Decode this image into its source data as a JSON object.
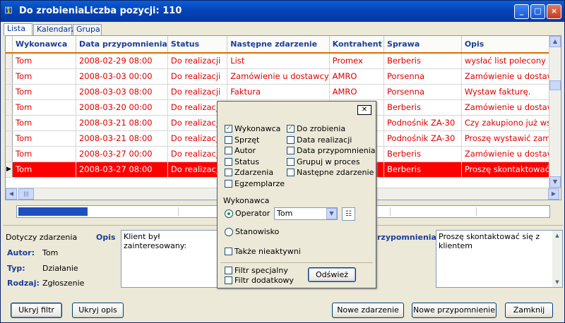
{
  "window": {
    "title": "Do zrobienia",
    "count_label": "Liczba pozycji: 110",
    "minimize_icon": "_",
    "maximize_icon": "□",
    "close_icon": "×"
  },
  "tabs": [
    {
      "label": "Lista",
      "active": true
    },
    {
      "label": "Kalendarz",
      "active": false
    },
    {
      "label": "Grupa",
      "active": false
    }
  ],
  "grid": {
    "columns": [
      "Wykonawca",
      "Data przypomnienia",
      "Status",
      "Następne zdarzenie",
      "Kontrahent",
      "Sprawa",
      "Opis"
    ],
    "rows": [
      {
        "cells": [
          "Tom",
          "2008-02-29 08:00",
          "Do realizacji",
          "List",
          "Promex",
          "Berberis",
          "wysłać list polecony"
        ],
        "selected": false
      },
      {
        "cells": [
          "Tom",
          "2008-03-03 00:00",
          "Do realizacji",
          "Zamówienie u dostawcy",
          "AMRO",
          "Porsenna",
          "Zamówienie u dostaw"
        ],
        "selected": false
      },
      {
        "cells": [
          "Tom",
          "2008-03-03 08:00",
          "Do realizacji",
          "Faktura",
          "AMRO",
          "Porsenna",
          "Wystaw fakturę."
        ],
        "selected": false
      },
      {
        "cells": [
          "Tom",
          "2008-03-20 00:00",
          "Do realizacji",
          "",
          "",
          "Berberis",
          "Zamówienie u dostaw"
        ],
        "selected": false
      },
      {
        "cells": [
          "Tom",
          "2008-03-21 08:00",
          "Do realizacji",
          "",
          "",
          "Podnośnik ZA-30",
          "Czy zakupiono już wszy"
        ],
        "selected": false
      },
      {
        "cells": [
          "Tom",
          "2008-03-21 08:00",
          "Do realizacji",
          "",
          "",
          "Podnośnik ZA-30",
          "Proszę wystawić zamó"
        ],
        "selected": false
      },
      {
        "cells": [
          "Tom",
          "2008-03-27 00:00",
          "Do realizacji",
          "",
          "",
          "Berberis",
          "Zamówienie u dostaw"
        ],
        "selected": false
      },
      {
        "cells": [
          "Tom",
          "2008-03-27 08:00",
          "Do realizacji",
          "",
          "",
          "Berberis",
          "Proszę skontaktować si"
        ],
        "selected": true
      }
    ],
    "row_indicator": "▶",
    "hscroll_left": "◀",
    "hscroll_right": "▶",
    "vscroll_up": "▲",
    "vscroll_down": "▼",
    "hscroll_thumb": "|||"
  },
  "progress": {
    "fraction": 0.13
  },
  "details": {
    "dotyczy_label": "Dotyczy zdarzenia",
    "opis_label": "Opis",
    "autor_label": "Autor:",
    "autor_value": "Tom",
    "typ_label": "Typ:",
    "typ_value": "Działanie",
    "rodzaj_label": "Rodzaj:",
    "rodzaj_value": "Zgłoszenie",
    "opis_text": "Klient był zainteresowany:",
    "przypomnienia_label": "rzypomnienia",
    "przypomnienia_text": "Proszę skontaktować się z klientem"
  },
  "buttons": {
    "ukryj_filtr": "Ukryj filtr",
    "ukryj_opis": "Ukryj opis",
    "nowe_zdarzenie": "Nowe zdarzenie",
    "nowe_przypomnienie": "Nowe przypomnienie",
    "zamknij": "Zamknij"
  },
  "filter": {
    "close_icon": "✕",
    "left_checks": [
      {
        "label": "Wykonawca",
        "checked": true
      },
      {
        "label": "Sprzęt",
        "checked": false
      },
      {
        "label": "Autor",
        "checked": false
      },
      {
        "label": "Status",
        "checked": false
      },
      {
        "label": "Zdarzenia",
        "checked": false
      },
      {
        "label": "Egzemplarze",
        "checked": false
      }
    ],
    "right_checks": [
      {
        "label": "Do zrobienia",
        "checked": true
      },
      {
        "label": "Data realizacji",
        "checked": false
      },
      {
        "label": "Data przypomnienia",
        "checked": false
      },
      {
        "label": "Grupuj w proces",
        "checked": false
      },
      {
        "label": "Następne zdarzenie",
        "checked": false
      }
    ],
    "wykonawca_label": "Wykonawca",
    "operator_label": "Operator",
    "operator_selected": true,
    "operator_value": "Tom",
    "stanowisko_label": "Stanowisko",
    "stanowisko_selected": false,
    "takze_label": "Także nieaktywni",
    "filtr_specjalny": "Filtr specjalny",
    "filtr_dodatkowy": "Filtr dodatkowy",
    "odswiez": "Odśwież",
    "combo_drop": "▼",
    "check_mark": "✓"
  },
  "colors": {
    "row_text": "#e00000",
    "selected_row_bg": "#ff0000",
    "header_text": "#1a3f9a",
    "header_border": "#e06a00",
    "titlebar": "#0444b8"
  }
}
